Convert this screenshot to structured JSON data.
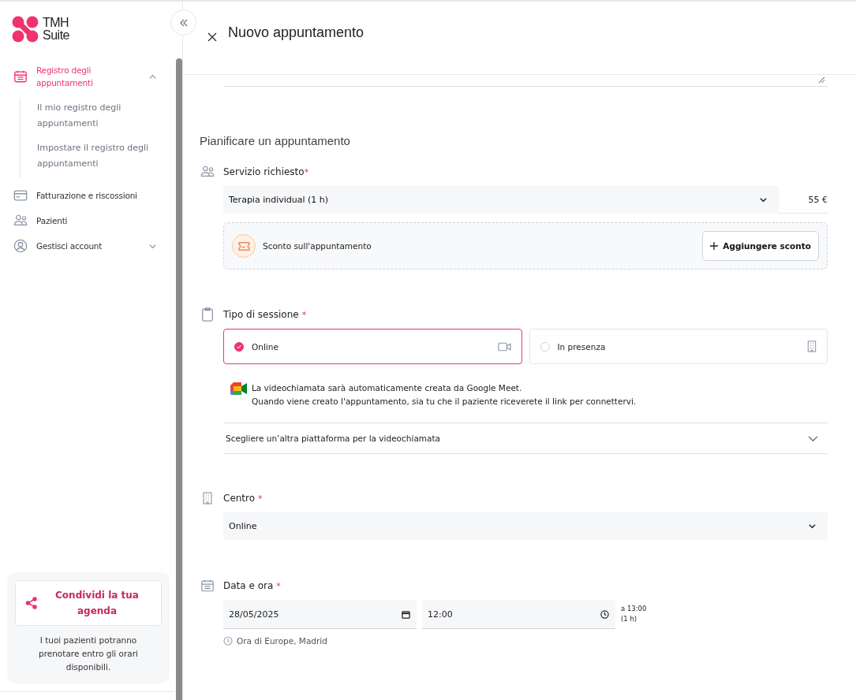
{
  "logo": {
    "line1": "TMH",
    "line2": "Suite"
  },
  "nav": [
    {
      "kind": "calendar",
      "label": "Registro degli appuntamenti",
      "selected": true,
      "expanded": true,
      "children": [
        {
          "label": "Il mio registro degli appuntamenti"
        },
        {
          "label": "Impostare il registro degli appuntamenti"
        }
      ]
    },
    {
      "kind": "card",
      "label": "Fatturazione e riscossioni",
      "selected": false
    },
    {
      "kind": "people",
      "label": "Pazienti",
      "selected": false
    },
    {
      "kind": "account",
      "label": "Gestisci account",
      "selected": false,
      "expanded": false
    }
  ],
  "share_card": {
    "button": "Condividi la tua agenda",
    "text": "I tuoi pazienti potranno prenotare entro gli orari disponibili."
  },
  "header": {
    "title": "Nuovo appuntamento"
  },
  "section_title": "Pianificare un appuntamento",
  "service": {
    "label": "Servizio richiesto",
    "required_mark": "*",
    "value": "Terapia individual (1 h)",
    "price": "55 €",
    "discount_label": "Sconto sull'appuntamento",
    "add_button": "Aggiungere sconto"
  },
  "session": {
    "label": "Tipo di sessione",
    "required_mark": "*",
    "options": [
      {
        "kind": "video",
        "label": "Online",
        "selected": true
      },
      {
        "kind": "building",
        "label": "In presenza",
        "selected": false
      }
    ],
    "notice": [
      "La videochiamata sarà automaticamente creata da Google Meet.",
      "Quando viene creato l'appuntamento, sia tu che il paziente riceverete il link per connettervi."
    ],
    "platform_select": "Scegliere un’altra piattaforma per la videochiamata"
  },
  "centre": {
    "label": "Centro",
    "required_mark": "*",
    "value": "Online"
  },
  "datetime": {
    "label": "Data e ora",
    "required_mark": "*",
    "date": "28/05/2025",
    "time": "12:00",
    "end": "a 13:00",
    "duration": "(1 h)",
    "timezone": "Ora di Europe, Madrid"
  }
}
